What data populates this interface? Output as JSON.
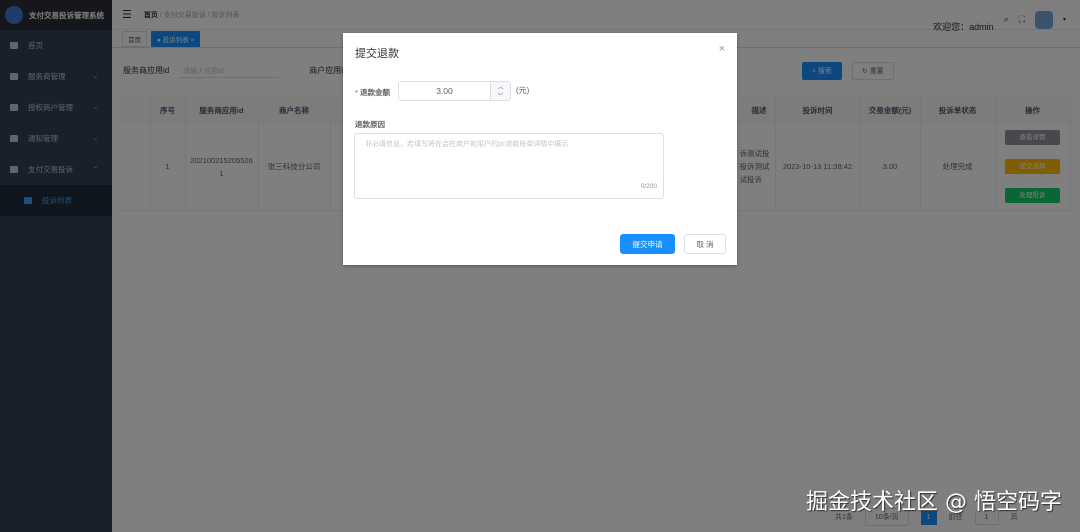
{
  "app_title": "支付交易投诉管理系统",
  "sidebar": {
    "items": [
      {
        "label": "首页"
      },
      {
        "label": "服务商管理"
      },
      {
        "label": "授权商户管理"
      },
      {
        "label": "通知管理"
      },
      {
        "label": "支付交易投诉"
      }
    ],
    "sub_items": [
      {
        "label": "投诉列表"
      }
    ]
  },
  "header": {
    "breadcrumb": [
      "首页",
      "支付交易投诉",
      "投诉列表"
    ],
    "welcome": "欢迎您：admin"
  },
  "tags": [
    {
      "label": "首页"
    },
    {
      "label": "● 投诉列表 ×"
    }
  ],
  "search": {
    "field1_label": "服务商应用id",
    "field1_placeholder": "请输入应用id",
    "field2_label": "商户应用id",
    "search_label": "搜索",
    "reset_label": "重置"
  },
  "table": {
    "headers": [
      "序号",
      "服务商应用id",
      "商户名称",
      "描述",
      "投诉时间",
      "交易金额(元)",
      "投诉单状态",
      "操作"
    ],
    "rows": [
      {
        "index": "1",
        "service_app_id": "2021002152055261",
        "merchant": "张三科技分公司",
        "desc": "诉测试投 投诉测试 试投诉",
        "time": "2023-10-13 11:38:42",
        "amount": "3.00",
        "status": "处理完成"
      }
    ],
    "actions": [
      "查看详情",
      "提交退款",
      "处理投诉"
    ]
  },
  "pagination": {
    "total": "共1条",
    "page_size": "10条/页",
    "current": "1",
    "goto_label": "前往",
    "goto_value": "1",
    "page_unit": "页"
  },
  "dialog": {
    "title": "提交退款",
    "amount_label": "退款金额",
    "amount_value": "3.00",
    "unit": "(元)",
    "reason_label": "退款原因",
    "reason_placeholder": "非必填信息，若填写将在会在商户和用户的pc退款账单详情中展示",
    "counter": "0/200",
    "submit_label": "提交申请",
    "cancel_label": "取 消"
  },
  "watermark": "掘金技术社区 @ 悟空码字"
}
